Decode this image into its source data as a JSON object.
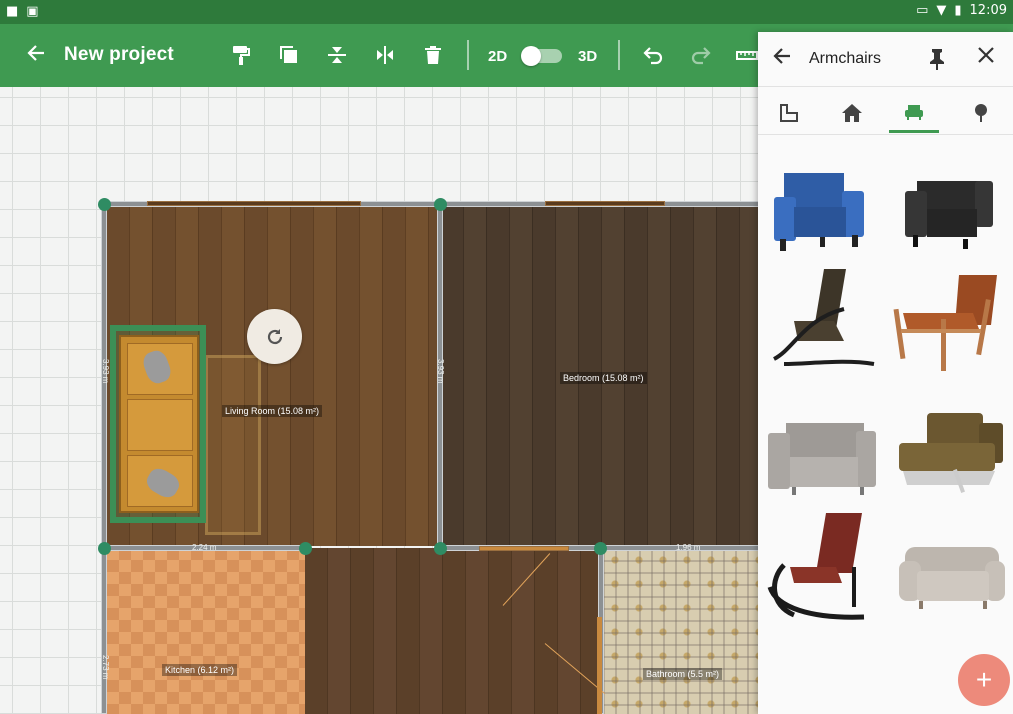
{
  "statusbar": {
    "time": "12:09"
  },
  "toolbar": {
    "back_icon": "arrow-left-icon",
    "title": "New project",
    "label_2d": "2D",
    "label_3d": "3D",
    "toggle_state": "2D"
  },
  "floorplan": {
    "rooms": [
      {
        "label": "Living Room (15.08 m²)"
      },
      {
        "label": "Bedroom (15.08 m²)"
      },
      {
        "label": "Kitchen (6.12 m²)"
      },
      {
        "label": "Bathroom (5.5 m²)"
      }
    ],
    "dimensions": [
      "3.93 m",
      "3.93 m",
      "2.24 m",
      "1.96 m",
      "2.73 m"
    ]
  },
  "panel": {
    "title": "Armchairs",
    "tabs": [
      {
        "icon": "floor-plan-icon"
      },
      {
        "icon": "house-icon"
      },
      {
        "icon": "armchair-icon",
        "active": true
      },
      {
        "icon": "tree-icon"
      }
    ],
    "items": [
      {
        "name": "blue armchair",
        "color": "#2f5da6"
      },
      {
        "name": "black armchair",
        "color": "#2b2b2b"
      },
      {
        "name": "dark recliner armchair",
        "color": "#3d3528"
      },
      {
        "name": "wooden lounge armchair",
        "color": "#9a4a22"
      },
      {
        "name": "gray armchair",
        "color": "#9e9a96"
      },
      {
        "name": "olive folding armchair",
        "color": "#6b5730"
      },
      {
        "name": "rocking chair",
        "color": "#7a2a22"
      },
      {
        "name": "light gray tufted armchair",
        "color": "#bdb6ae"
      }
    ]
  },
  "fab": {
    "label": "+"
  }
}
